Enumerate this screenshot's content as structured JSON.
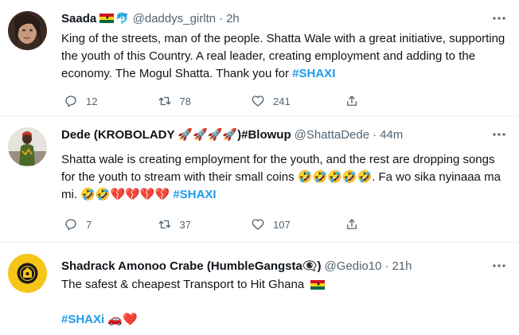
{
  "tweets": [
    {
      "name": "Saada",
      "handle": "@daddys_girltn",
      "time": "2h",
      "body_text": "King of the streets, man of the people. Shatta Wale with a great initiative, supporting the youth of this Country. A real leader, creating employment and adding to the economy. The Mogul Shatta. Thank you for ",
      "hashtag": "#SHAXI",
      "replies": "12",
      "retweets": "78",
      "likes": "241"
    },
    {
      "name": "Dede (KROBOLADY 🚀🚀🚀🚀)#Blowup",
      "handle": "@ShattaDede",
      "time": "44m",
      "body_text": "Shatta wale is creating employment for the youth, and the rest are dropping songs for the youth to stream with their small coins 🤣🤣🤣🤣🤣. Fa wo sika nyinaaa ma mi. 🤣🤣💔💔💔💔 ",
      "hashtag": "#SHAXI",
      "replies": "7",
      "retweets": "37",
      "likes": "107"
    },
    {
      "name": "Shadrack Amonoo Crabe (HumbleGangsta👁‍🗨)",
      "handle": "@Gedio10",
      "time": "21h",
      "line1": "The safest & cheapest Transport to Hit Ghana",
      "hashtag": "#SHAXi",
      "hashtag_suffix": " 🚗❤️"
    }
  ],
  "icons": {
    "reply": "reply-icon",
    "retweet": "retweet-icon",
    "like": "heart-icon",
    "share": "share-icon",
    "more": "more-icon"
  },
  "colors": {
    "hashtag": "#1d9bf0",
    "secondary_text": "#536471",
    "divider": "#eff3f4"
  }
}
